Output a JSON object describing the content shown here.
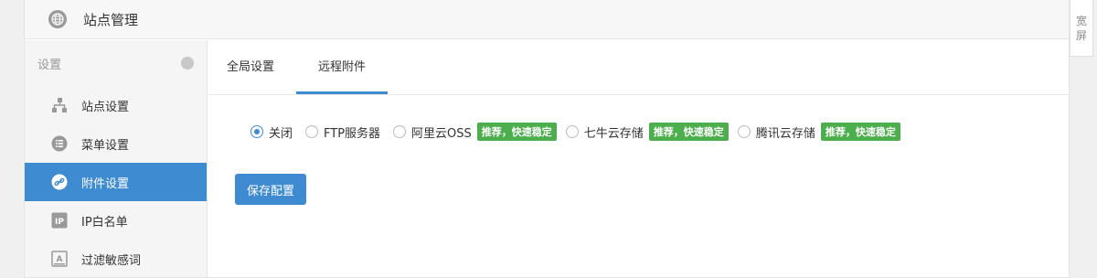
{
  "header": {
    "title": "站点管理",
    "icon": "globe-icon"
  },
  "sidebar": {
    "group_label": "设置",
    "items": [
      {
        "label": "站点设置",
        "icon": "sitemap-icon"
      },
      {
        "label": "菜单设置",
        "icon": "list-icon"
      },
      {
        "label": "附件设置",
        "icon": "link-icon",
        "active": true
      },
      {
        "label": "IP白名单",
        "icon": "ip-icon"
      },
      {
        "label": "过滤敏感词",
        "icon": "filter-icon"
      }
    ]
  },
  "tabs": [
    {
      "label": "全局设置"
    },
    {
      "label": "远程附件",
      "active": true
    }
  ],
  "storage_options": [
    {
      "label": "关闭",
      "checked": true
    },
    {
      "label": "FTP服务器"
    },
    {
      "label": "阿里云OSS",
      "badge": "推荐，快速稳定"
    },
    {
      "label": "七牛云存储",
      "badge": "推荐，快速稳定"
    },
    {
      "label": "腾讯云存储",
      "badge": "推荐，快速稳定"
    }
  ],
  "save_button": "保存配置",
  "wide_toggle": {
    "line1": "宽",
    "line2": "屏"
  },
  "colors": {
    "accent": "#3e8bd1",
    "badge_green": "#4cae4c"
  }
}
